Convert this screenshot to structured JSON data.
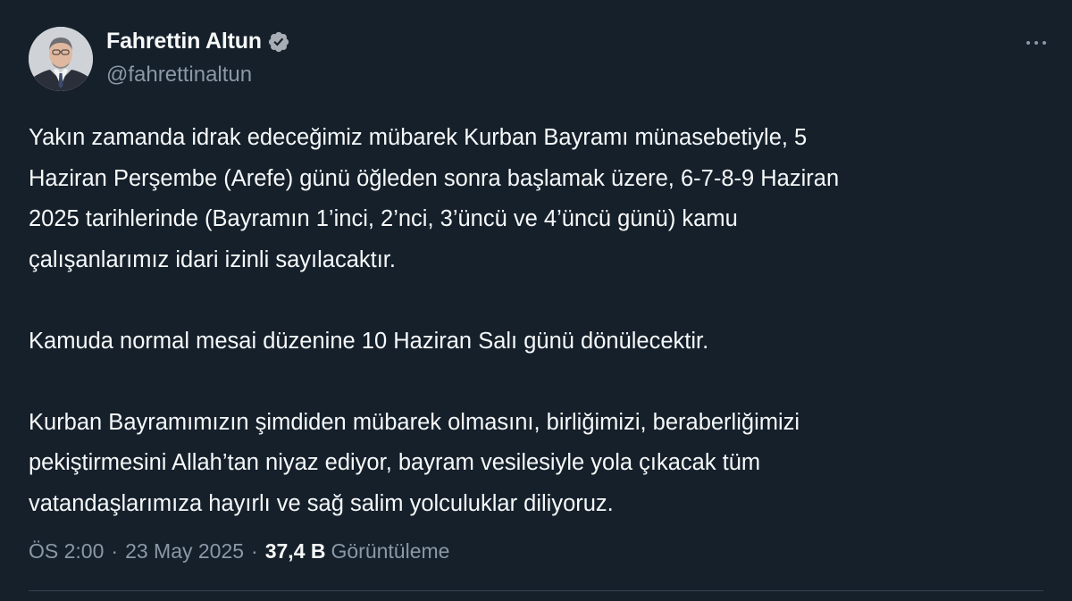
{
  "author": {
    "display_name": "Fahrettin Altun",
    "handle": "@fahrettinaltun",
    "verified": true,
    "avatar_icon": "profile-photo"
  },
  "tweet": {
    "paragraph_1": [
      "Yakın zamanda idrak edeceğimiz mübarek Kurban Bayramı münasebetiyle, 5",
      "Haziran Perşembe (Arefe) günü öğleden sonra başlamak üzere, 6-7-8-9 Haziran",
      "2025 tarihlerinde (Bayramın 1’inci, 2’nci, 3’üncü ve 4’üncü günü) kamu",
      "çalışanlarımız idari izinli sayılacaktır."
    ],
    "paragraph_2": [
      "Kamuda normal mesai düzenine 10 Haziran Salı günü dönülecektir."
    ],
    "paragraph_3": [
      "Kurban Bayramımızın şimdiden mübarek olmasını, birliğimizi, beraberliğimizi",
      "pekiştirmesini Allah’tan niyaz ediyor, bayram vesilesiyle yola çıkacak tüm",
      "vatandaşlarımıza hayırlı ve sağ salim yolculuklar diliyoruz."
    ]
  },
  "meta": {
    "time": "ÖS 2:00",
    "separator": "·",
    "date": "23 May 2025",
    "views_count": "37,4 B",
    "views_label": "Görüntüleme"
  },
  "colors": {
    "background": "#15202b",
    "text_primary": "#f7f9f9",
    "text_secondary": "#8b98a5",
    "verified_badge": "#a7adb3",
    "divider": "#38444d"
  },
  "icons": {
    "verified": "verified-badge-icon",
    "more": "more-options-icon"
  }
}
